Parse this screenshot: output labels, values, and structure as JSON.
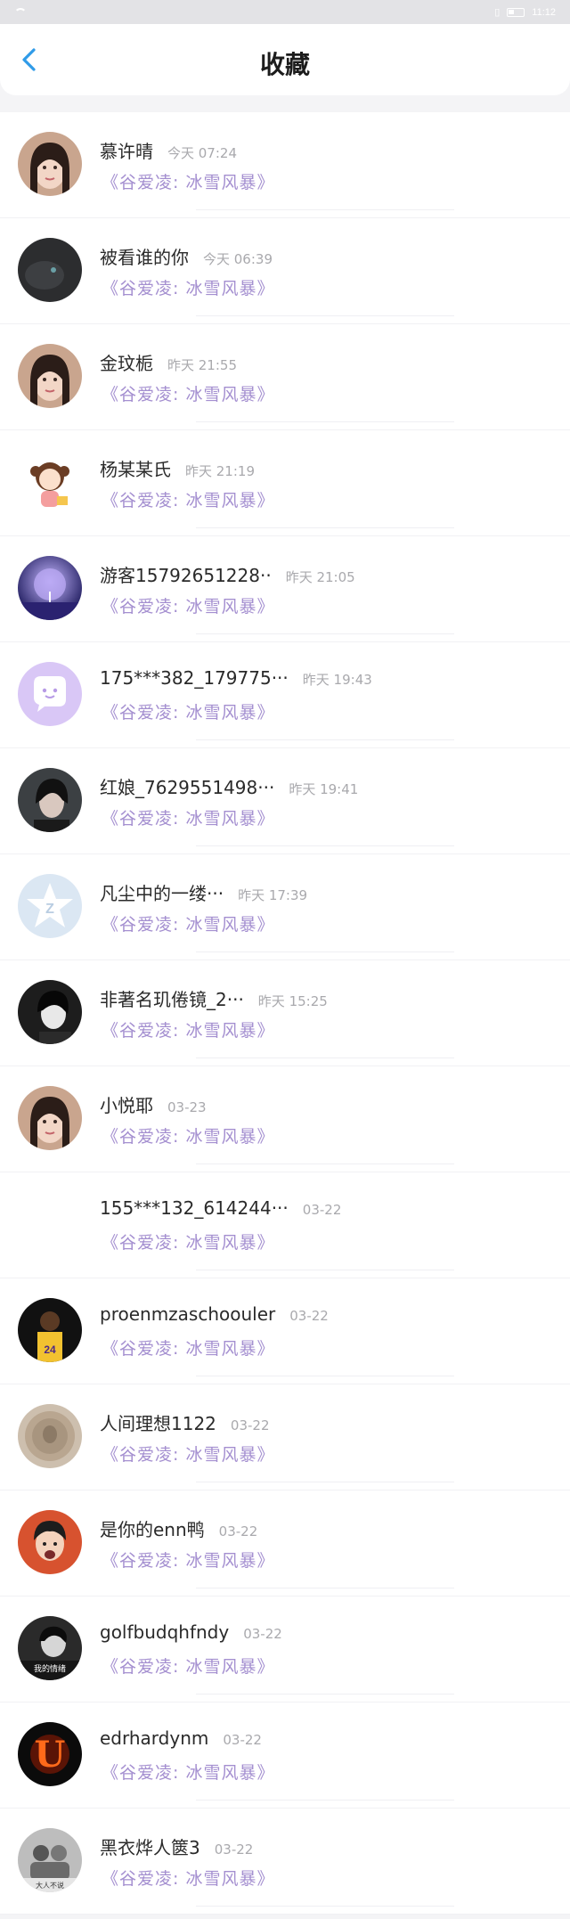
{
  "status_bar": {
    "left": "",
    "right": "11:12"
  },
  "header": {
    "title": "收藏"
  },
  "accent": "#2f9be8",
  "song_color": "#a48fd0",
  "items": [
    {
      "name": "慕许晴",
      "time": "今天 07:24",
      "song": "《谷爱凌: 冰雪风暴》",
      "avatar": "woman-portrait"
    },
    {
      "name": "被看谁的你",
      "time": "今天 06:39",
      "song": "《谷爱凌: 冰雪风暴》",
      "avatar": "dark-photo"
    },
    {
      "name": "金玟栀",
      "time": "昨天 21:55",
      "song": "《谷爱凌: 冰雪风暴》",
      "avatar": "woman-portrait"
    },
    {
      "name": "杨某某氏",
      "time": "昨天 21:19",
      "song": "《谷爱凌: 冰雪风暴》",
      "avatar": "cartoon-girl"
    },
    {
      "name": "游客15792651228··",
      "time": "昨天 21:05",
      "song": "《谷爱凌: 冰雪风暴》",
      "avatar": "moon-scene"
    },
    {
      "name": "175***382_179775···",
      "time": "昨天 19:43",
      "song": "《谷爱凌: 冰雪风暴》",
      "avatar": "chat-bubble"
    },
    {
      "name": "红娘_7629551498···",
      "time": "昨天 19:41",
      "song": "《谷爱凌: 冰雪风暴》",
      "avatar": "dark-portrait"
    },
    {
      "name": "凡尘中的一缕···",
      "time": "昨天 17:39",
      "song": "《谷爱凌: 冰雪风暴》",
      "avatar": "default-star"
    },
    {
      "name": "非著名玑倦镜_2···",
      "time": "昨天 15:25",
      "song": "《谷爱凌: 冰雪风暴》",
      "avatar": "bw-portrait"
    },
    {
      "name": "小悦耶",
      "time": "03-23",
      "song": "《谷爱凌: 冰雪风暴》",
      "avatar": "woman-portrait"
    },
    {
      "name": "155***132_614244···",
      "time": "03-22",
      "song": "《谷爱凌: 冰雪风暴》",
      "avatar": "blank"
    },
    {
      "name": "proenmzaschoouler",
      "time": "03-22",
      "song": "《谷爱凌: 冰雪风暴》",
      "avatar": "basketball-player"
    },
    {
      "name": "人间理想1122",
      "time": "03-22",
      "song": "《谷爱凌: 冰雪风暴》",
      "avatar": "coin"
    },
    {
      "name": "是你的enn鸭",
      "time": "03-22",
      "song": "《谷爱凌: 冰雪风暴》",
      "avatar": "boy-red"
    },
    {
      "name": "golfbudqhfndy",
      "time": "03-22",
      "song": "《谷爱凌: 冰雪风暴》",
      "avatar": "bw-text"
    },
    {
      "name": "edrhardynm",
      "time": "03-22",
      "song": "《谷爱凌: 冰雪风暴》",
      "avatar": "fire-letter"
    },
    {
      "name": "黑衣烨人篋3",
      "time": "03-22",
      "song": "《谷爱凌: 冰雪风暴》",
      "avatar": "bw-group"
    }
  ],
  "avatar_text": {
    "fire-letter": "U",
    "bw-text": "我的情绪",
    "bw-group": "大人不说"
  }
}
